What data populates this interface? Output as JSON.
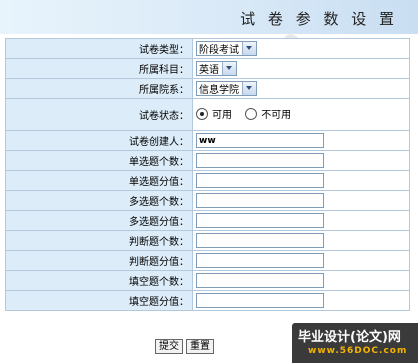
{
  "header": {
    "title": "试 卷 参 数 设 置"
  },
  "form": {
    "exam_type": {
      "label": "试卷类型：",
      "value": "阶段考试"
    },
    "subject": {
      "label": "所属科目：",
      "value": "英语"
    },
    "department": {
      "label": "所属院系：",
      "value": "信息学院"
    },
    "status": {
      "label": "试卷状态：",
      "options": [
        "可用",
        "不可用"
      ],
      "selected": "可用"
    },
    "creator": {
      "label": "试卷创建人：",
      "value": "ww"
    },
    "single_count": {
      "label": "单选题个数：",
      "value": ""
    },
    "single_score": {
      "label": "单选题分值：",
      "value": ""
    },
    "multi_count": {
      "label": "多选题个数：",
      "value": ""
    },
    "multi_score": {
      "label": "多选题分值：",
      "value": ""
    },
    "judge_count": {
      "label": "判断题个数：",
      "value": ""
    },
    "judge_score": {
      "label": "判断题分值：",
      "value": ""
    },
    "fill_count": {
      "label": "填空题个数：",
      "value": ""
    },
    "fill_score": {
      "label": "填空题分值：",
      "value": ""
    }
  },
  "buttons": {
    "submit": "提交",
    "reset": "重置"
  },
  "watermark": {
    "text": "56doc.com"
  },
  "logo": {
    "top": "毕业设计(论文)网",
    "bottom": "www.56DOC.com"
  },
  "colors": {
    "header_bg": "#dcebf8",
    "label_bg": "#dcecf8",
    "border": "#b4c8dc",
    "logo_accent": "#f5b400"
  },
  "icons": {
    "select_arrow": "chevron-down-icon",
    "radio": "radio-icon"
  }
}
